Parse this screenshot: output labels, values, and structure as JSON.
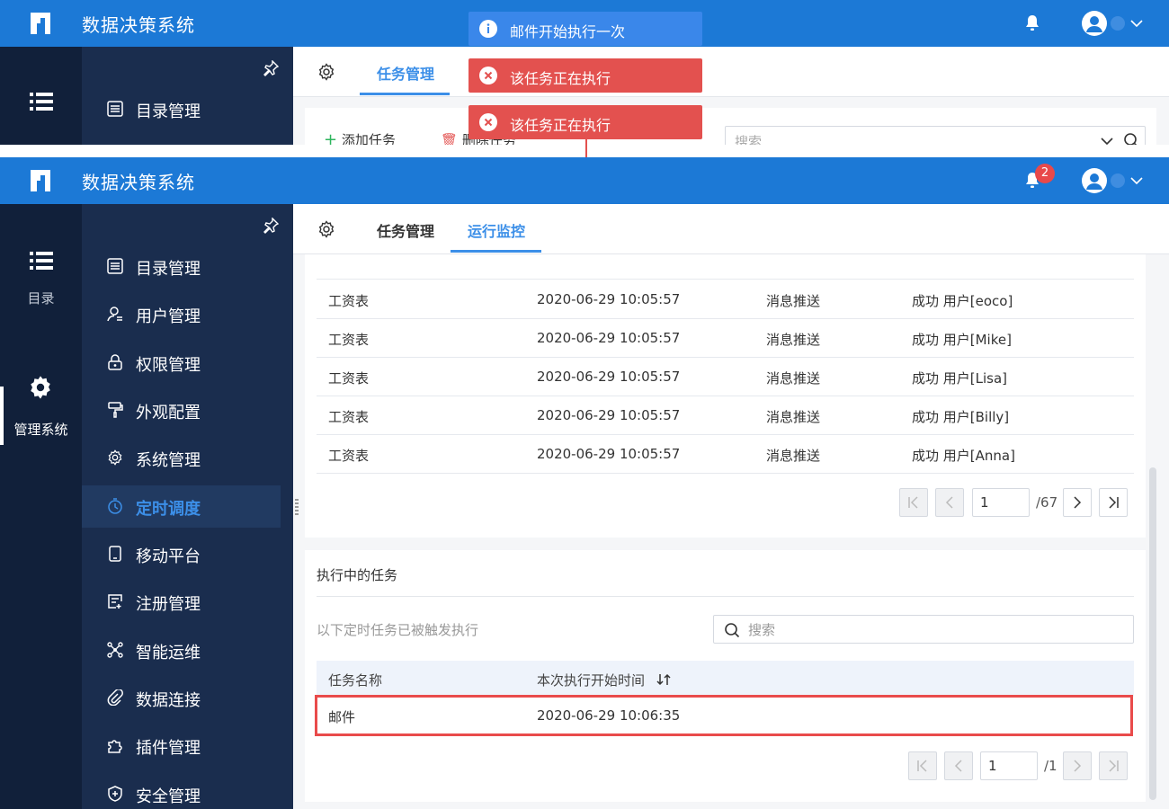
{
  "app": {
    "title": "数据决策系统",
    "notification_count": "2"
  },
  "toasts": [
    {
      "type": "info",
      "text": "邮件开始执行一次"
    },
    {
      "type": "error",
      "text": "该任务正在执行"
    },
    {
      "type": "error",
      "text": "该任务正在执行"
    }
  ],
  "top_frame": {
    "tab": "任务管理",
    "menu_first": "目录管理",
    "toolbar": {
      "add_label": "添加任务",
      "delete_label": "删除任务",
      "search_placeholder": "搜索"
    }
  },
  "sidebar_left": {
    "items": [
      {
        "label": "目录",
        "icon": "list-icon"
      },
      {
        "label": "管理系统",
        "icon": "gear-icon",
        "active": true
      }
    ]
  },
  "sidebar_menu": {
    "items": [
      {
        "label": "目录管理",
        "icon": "catalog-icon"
      },
      {
        "label": "用户管理",
        "icon": "user-icon"
      },
      {
        "label": "权限管理",
        "icon": "lock-icon"
      },
      {
        "label": "外观配置",
        "icon": "brush-icon"
      },
      {
        "label": "系统管理",
        "icon": "gear-icon"
      },
      {
        "label": "定时调度",
        "icon": "timer-icon",
        "active": true
      },
      {
        "label": "移动平台",
        "icon": "mobile-icon"
      },
      {
        "label": "注册管理",
        "icon": "register-icon"
      },
      {
        "label": "智能运维",
        "icon": "ops-icon"
      },
      {
        "label": "数据连接",
        "icon": "link-icon"
      },
      {
        "label": "插件管理",
        "icon": "plugin-icon"
      },
      {
        "label": "安全管理",
        "icon": "shield-icon"
      }
    ]
  },
  "tabs": [
    {
      "label": "任务管理"
    },
    {
      "label": "运行监控",
      "active": true
    }
  ],
  "history": {
    "rows": [
      {
        "name": "工资表",
        "time": "2020-06-29 10:05:57",
        "type": "消息推送",
        "result": "成功 用户[eoco]"
      },
      {
        "name": "工资表",
        "time": "2020-06-29 10:05:57",
        "type": "消息推送",
        "result": "成功 用户[Mike]"
      },
      {
        "name": "工资表",
        "time": "2020-06-29 10:05:57",
        "type": "消息推送",
        "result": "成功 用户[Lisa]"
      },
      {
        "name": "工资表",
        "time": "2020-06-29 10:05:57",
        "type": "消息推送",
        "result": "成功 用户[Billy]"
      },
      {
        "name": "工资表",
        "time": "2020-06-29 10:05:57",
        "type": "消息推送",
        "result": "成功 用户[Anna]"
      }
    ],
    "pagination": {
      "page": "1",
      "total": "/67"
    }
  },
  "running": {
    "title": "执行中的任务",
    "subtitle": "以下定时任务已被触发执行",
    "search_placeholder": "搜索",
    "columns": [
      "任务名称",
      "本次执行开始时间"
    ],
    "rows": [
      {
        "name": "邮件",
        "start_time": "2020-06-29 10:06:35"
      }
    ],
    "pagination": {
      "page": "1",
      "total": "/1"
    }
  },
  "colors": {
    "header": "#1c79d6",
    "accent": "#3c8fe8",
    "error": "#e3514f",
    "info": "#3a87ea",
    "highlight": "#e94b4b"
  }
}
